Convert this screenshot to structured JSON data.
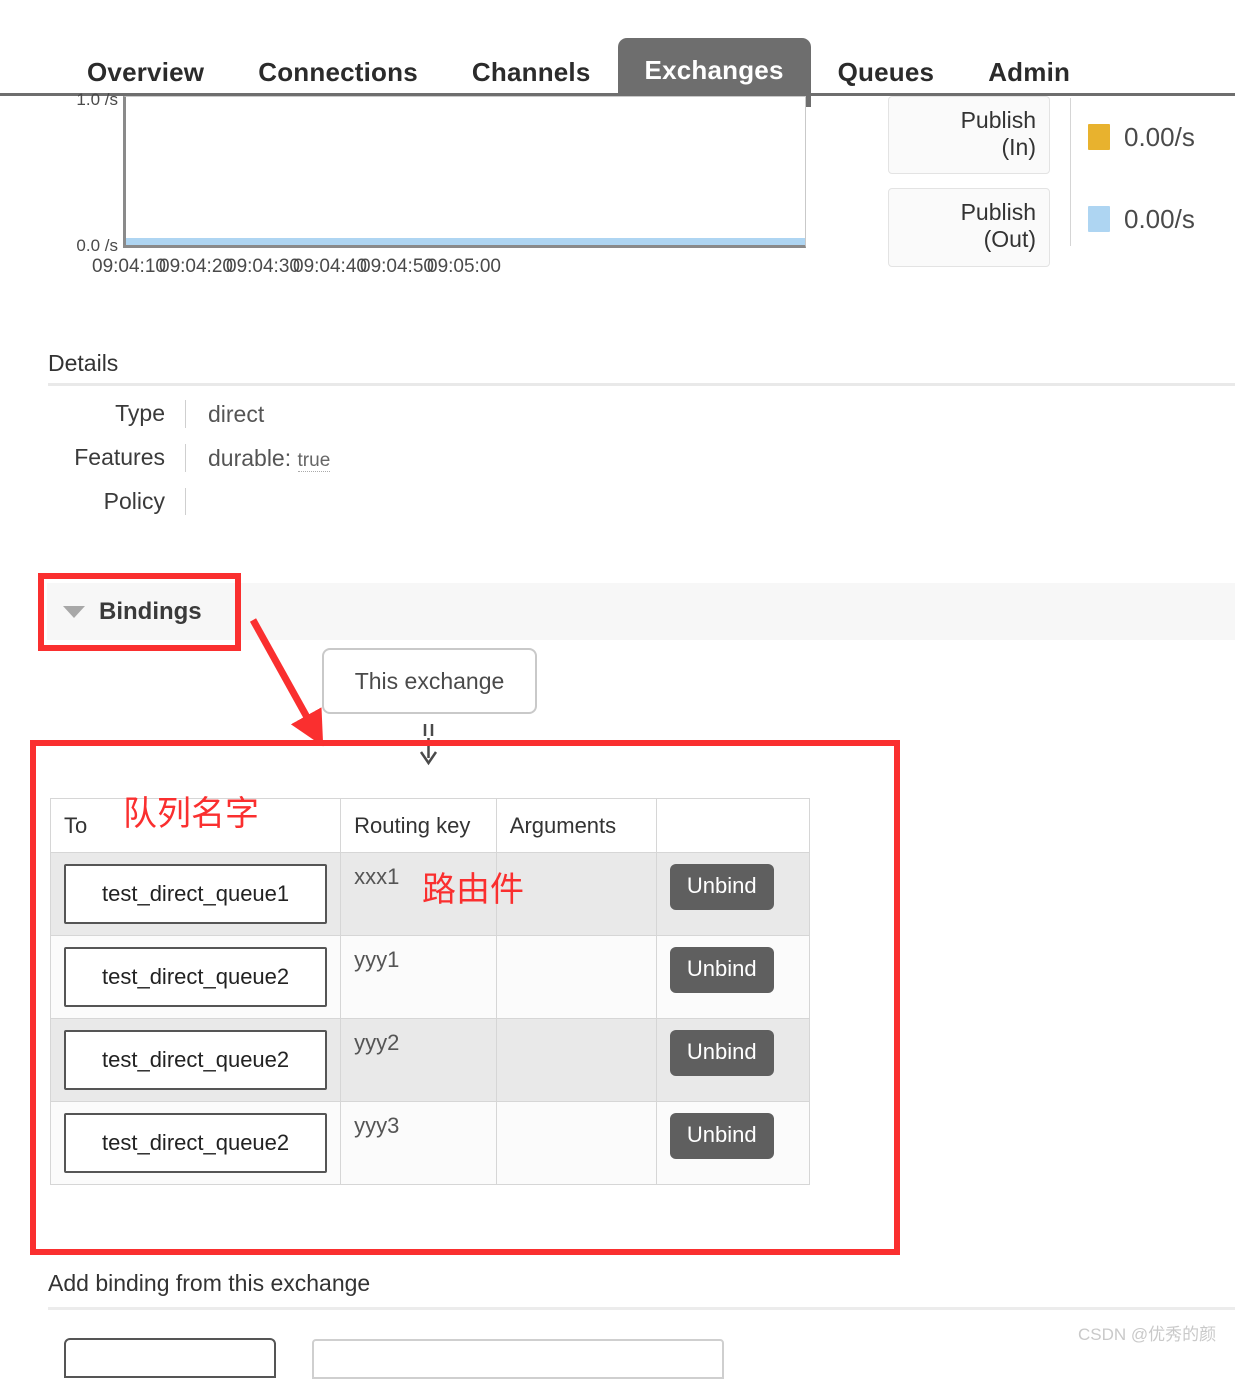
{
  "nav": {
    "tabs": [
      {
        "label": "Overview",
        "active": false
      },
      {
        "label": "Connections",
        "active": false
      },
      {
        "label": "Channels",
        "active": false
      },
      {
        "label": "Exchanges",
        "active": true
      },
      {
        "label": "Queues",
        "active": false
      },
      {
        "label": "Admin",
        "active": false
      }
    ]
  },
  "chart_data": {
    "type": "area",
    "title": "",
    "xlabel": "",
    "ylabel": "",
    "x": [
      "09:04:10",
      "09:04:20",
      "09:04:30",
      "09:04:40",
      "09:04:50",
      "09:05:00"
    ],
    "ylim": [
      0.0,
      1.0
    ],
    "ytick_labels": [
      "1.0 /s",
      "0.0 /s"
    ],
    "grid": false,
    "legend_position": "right",
    "series": [
      {
        "name": "Publish (In)",
        "color": "#e8b22e",
        "rate": "0.00/s",
        "values": [
          0,
          0,
          0,
          0,
          0,
          0
        ]
      },
      {
        "name": "Publish (Out)",
        "color": "#aed5f2",
        "rate": "0.00/s",
        "values": [
          0,
          0,
          0,
          0,
          0,
          0
        ]
      }
    ]
  },
  "stats": {
    "boxes": [
      {
        "line1": "Publish",
        "line2": "(In)"
      },
      {
        "line1": "Publish",
        "line2": "(Out)"
      }
    ],
    "legend": [
      {
        "color": "#e8b22e",
        "value": "0.00/s"
      },
      {
        "color": "#aed5f2",
        "value": "0.00/s"
      }
    ]
  },
  "details": {
    "heading": "Details",
    "rows": [
      {
        "label": "Type",
        "value": "direct",
        "value_small": ""
      },
      {
        "label": "Features",
        "value": "durable:",
        "value_small": "true"
      },
      {
        "label": "Policy",
        "value": "",
        "value_small": ""
      }
    ]
  },
  "bindings": {
    "title": "Bindings",
    "this_exchange": "This exchange",
    "columns": [
      "To",
      "Routing key",
      "Arguments",
      ""
    ],
    "rows": [
      {
        "to": "test_direct_queue1",
        "routing_key": "xxx1",
        "arguments": "",
        "action": "Unbind"
      },
      {
        "to": "test_direct_queue2",
        "routing_key": "yyy1",
        "arguments": "",
        "action": "Unbind"
      },
      {
        "to": "test_direct_queue2",
        "routing_key": "yyy2",
        "arguments": "",
        "action": "Unbind"
      },
      {
        "to": "test_direct_queue2",
        "routing_key": "yyy3",
        "arguments": "",
        "action": "Unbind"
      }
    ]
  },
  "add_binding": {
    "heading": "Add binding from this exchange"
  },
  "annotations": {
    "queue_name": "队列名字",
    "routing_key": "路由件",
    "highlight_color": "#fa2f2f"
  },
  "watermark": "CSDN @优秀的颜"
}
